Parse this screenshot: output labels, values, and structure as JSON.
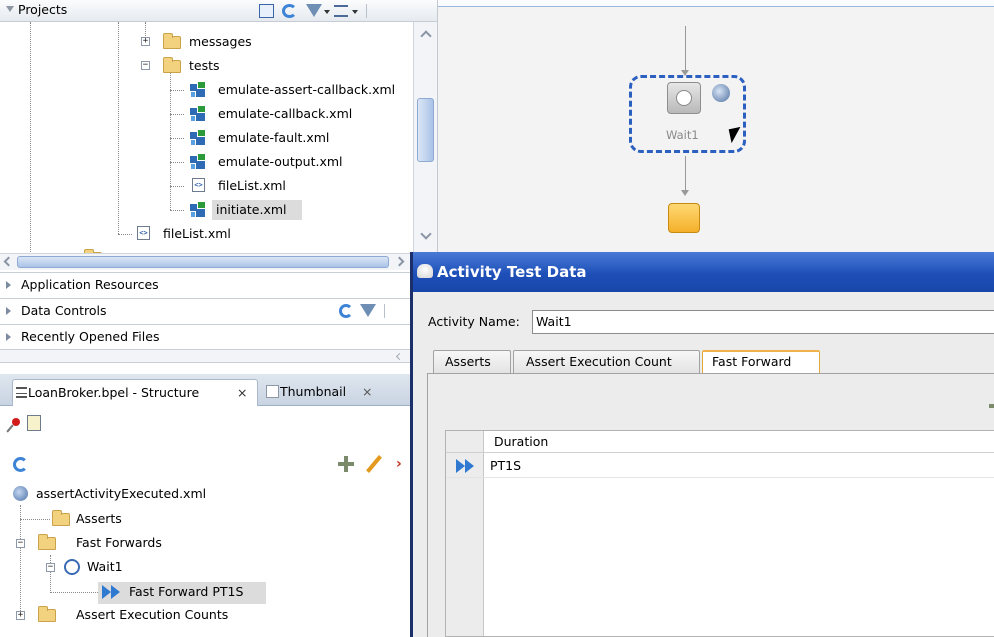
{
  "projects": {
    "title": "Projects",
    "tree": {
      "messages": "messages",
      "tests": "tests",
      "files": [
        "emulate-assert-callback.xml",
        "emulate-callback.xml",
        "emulate-fault.xml",
        "emulate-output.xml",
        "fileList.xml",
        "initiate.xml"
      ],
      "outer_file": "fileList.xml"
    }
  },
  "sections": [
    "Application Resources",
    "Data Controls",
    "Recently Opened Files"
  ],
  "structure": {
    "tab_label": "LoanBroker.bpel - Structure",
    "tab2_label": "Thumbnail",
    "close_glyph": "×",
    "root": "assertActivityExecuted.xml",
    "asserts": "Asserts",
    "fast_forwards": "Fast Forwards",
    "wait": "Wait1",
    "ff_item": "Fast Forward PT1S",
    "counts": "Assert Execution Counts"
  },
  "canvas": {
    "activity_label": "Wait1"
  },
  "dialog": {
    "title": "Activity Test Data",
    "name_label": "Activity Name:",
    "name_value": "Wait1",
    "tabs": [
      "Asserts",
      "Assert Execution Count",
      "Fast Forward"
    ],
    "grid": {
      "column": "Duration",
      "rows": [
        "PT1S"
      ]
    }
  },
  "colors": {
    "titlebar": "#2356c0",
    "selection": "#dcdcdc",
    "dashed_selection": "#2b5fc0"
  }
}
